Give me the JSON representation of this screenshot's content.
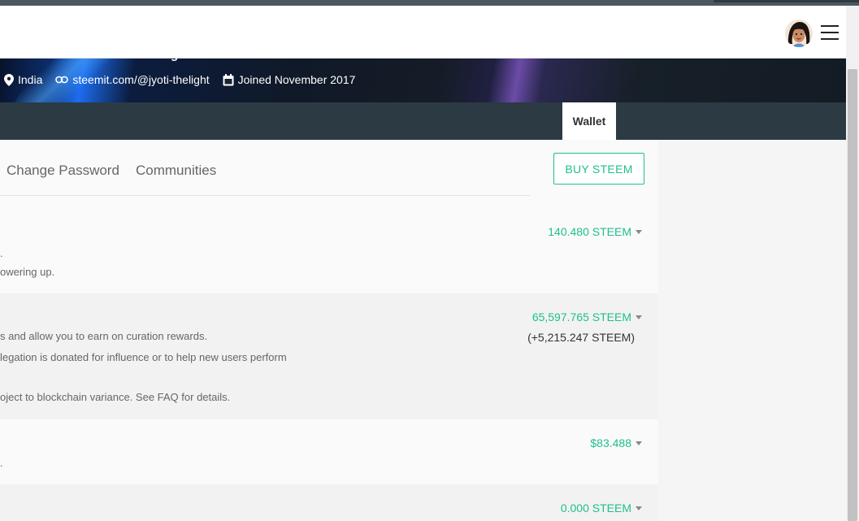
{
  "header": {
    "avatar_alt": "jyoti-thelight avatar",
    "menu_icon": "hamburger-menu-icon"
  },
  "profile": {
    "about_fragment": "designer",
    "location": "India",
    "website": "steemit.com/@jyoti-thelight",
    "joined": "Joined November 2017",
    "icons": [
      "location-pin-icon",
      "link-icon",
      "calendar-icon"
    ]
  },
  "nav": {
    "active_tab": "Wallet"
  },
  "subnav": {
    "links": [
      "Change Password",
      "Communities"
    ],
    "buy_button": "BUY STEEM"
  },
  "wallet": {
    "steem": {
      "desc_lines": [
        ".",
        "owering up."
      ],
      "amount": "140.480 STEEM"
    },
    "steem_power": {
      "desc_lines": [
        "s and allow you to earn on curation rewards.",
        "legation is donated for influence or to help new users perform",
        "oject to blockchain variance. See FAQ for details."
      ],
      "amount": "65,597.765 STEEM",
      "delegated": "(+5,215.247 STEEM)"
    },
    "steem_dollars": {
      "desc_lines": [
        "."
      ],
      "amount": "$83.488"
    },
    "savings": {
      "amount": "0.000 STEEM"
    }
  },
  "colors": {
    "accent": "#1fbf8f",
    "nav_bg": "#2c3a44",
    "header_bg": "#ffffff"
  }
}
